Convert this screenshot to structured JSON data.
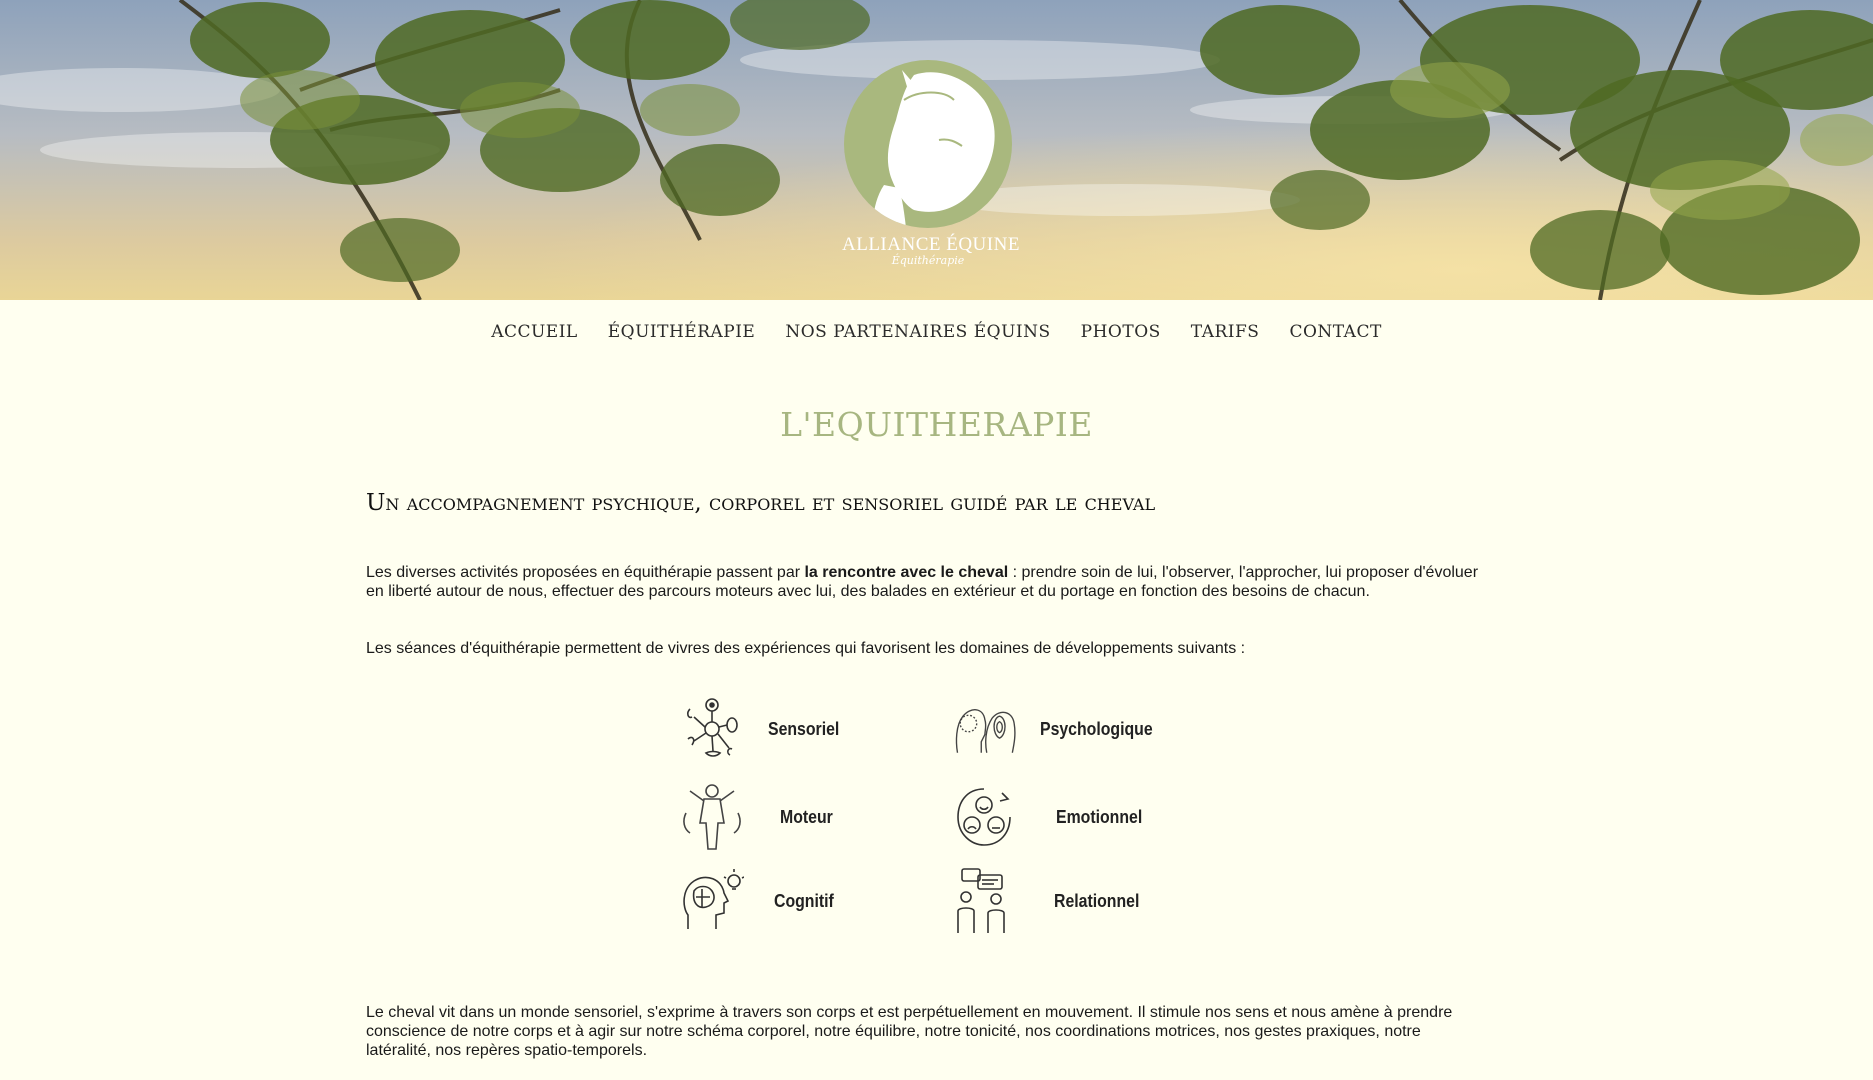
{
  "brand": {
    "name": "ALLIANCE ÉQUINE",
    "tagline": "Équithérapie",
    "logo_color": "#a9b87e"
  },
  "nav": {
    "items": [
      {
        "label": "ACCUEIL"
      },
      {
        "label": "ÉQUITHÉRAPIE"
      },
      {
        "label": "NOS PARTENAIRES ÉQUINS"
      },
      {
        "label": "PHOTOS"
      },
      {
        "label": "TARIFS"
      },
      {
        "label": "CONTACT"
      }
    ]
  },
  "main": {
    "title": "L'EQUITHERAPIE",
    "subtitle": "Un accompagnement psychique, corporel et sensoriel guidé par le cheval",
    "para1_before": "Les diverses activités proposées en équithérapie passent par ",
    "para1_bold": "la rencontre avec le cheval",
    "para1_after": " : prendre soin de lui, l'observer, l'approcher, lui proposer d'évoluer en liberté autour de nous, effectuer des parcours moteurs avec lui, des balades en extérieur et du portage en fonction des besoins de chacun.",
    "para2": "Les séances d'équithérapie permettent de vivres des expériences qui favorisent les domaines de développements suivants :",
    "para3": "Le cheval vit dans un monde sensoriel, s'exprime à travers son corps et est perpétuellement en mouvement. Il stimule nos sens et nous amène à prendre conscience de notre corps et à agir sur notre schéma corporel, notre équilibre, notre tonicité, nos coordinations motrices, nos gestes praxiques, notre latéralité, nos repères spatio-temporels."
  },
  "domains": [
    {
      "label": "Sensoriel",
      "icon": "senses-icon"
    },
    {
      "label": "Psychologique",
      "icon": "head-fingerprint-icon"
    },
    {
      "label": "Moteur",
      "icon": "body-movement-icon"
    },
    {
      "label": "Emotionnel",
      "icon": "emotions-icon"
    },
    {
      "label": "Cognitif",
      "icon": "brain-idea-icon"
    },
    {
      "label": "Relationnel",
      "icon": "conversation-icon"
    }
  ],
  "colors": {
    "background": "#fffff0",
    "accent": "#a7b681"
  }
}
